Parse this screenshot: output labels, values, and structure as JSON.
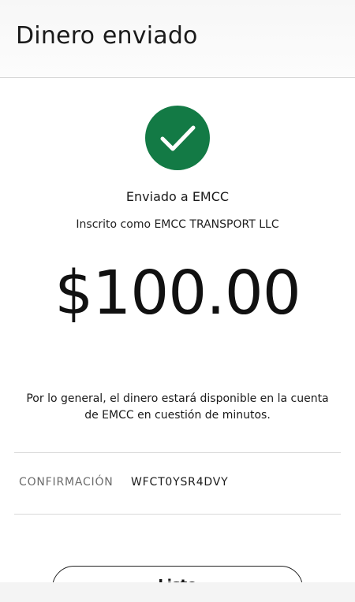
{
  "header": {
    "title": "Dinero enviado"
  },
  "status": {
    "icon": "check-circle-icon",
    "accent_color": "#137a45"
  },
  "recipient": {
    "sent_to": "Enviado a EMCC",
    "enrolled_as": "Inscrito como EMCC TRANSPORT LLC"
  },
  "transfer": {
    "amount": "$100.00"
  },
  "note": {
    "text": "Por lo general, el dinero estará disponible en la cuenta de EMCC en cuestión de minutos."
  },
  "confirmation": {
    "label": "CONFIRMACIÓN",
    "value": "WFCT0YSR4DVY"
  },
  "actions": {
    "done_label": "Listo"
  }
}
